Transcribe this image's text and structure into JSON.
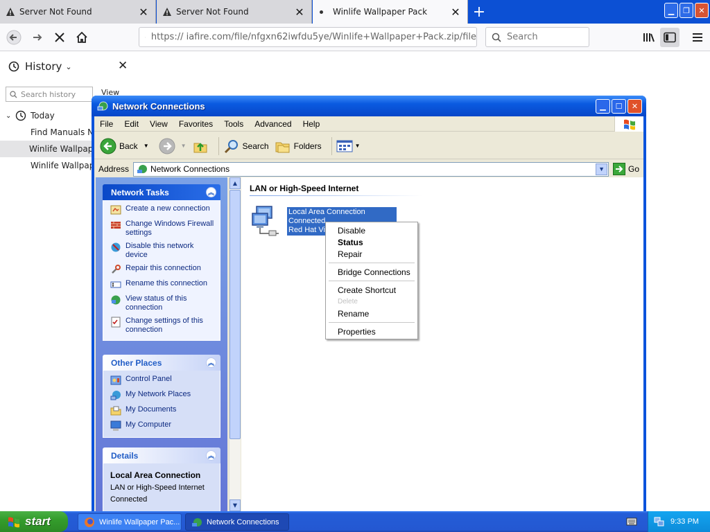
{
  "browser": {
    "tabs": [
      {
        "title": "Server Not Found",
        "close": "✕"
      },
      {
        "title": "Server Not Found",
        "close": "✕"
      },
      {
        "title": "Winlife Wallpaper Pack",
        "close": "✕"
      }
    ],
    "new_tab": "+",
    "url": "https://    iafire.com/file/nfgxn62iwfdu5ye/Winlife+Wallpaper+Pack.zip/file",
    "search_placeholder": "Search"
  },
  "sidebar": {
    "title": "History",
    "close": "✕",
    "search_placeholder": "Search history",
    "view_label": "View",
    "tree": [
      {
        "label": "Today"
      },
      {
        "label": "Find Manuals No"
      },
      {
        "label": "Winlife Wallpaper"
      },
      {
        "label": "Winlife Wallpaper"
      }
    ]
  },
  "window": {
    "title": "Network Connections",
    "menu": [
      "File",
      "Edit",
      "View",
      "Favorites",
      "Tools",
      "Advanced",
      "Help"
    ],
    "toolbar": {
      "back": "Back",
      "search": "Search",
      "folders": "Folders"
    },
    "address": {
      "label": "Address",
      "value": "Network Connections",
      "go": "Go"
    },
    "network_tasks": {
      "title": "Network Tasks",
      "items": [
        "Create a new connection",
        "Change Windows Firewall settings",
        "Disable this network device",
        "Repair this connection",
        "Rename this connection",
        "View status of this connection",
        "Change settings of this connection"
      ]
    },
    "other_places": {
      "title": "Other Places",
      "items": [
        "Control Panel",
        "My Network Places",
        "My Documents",
        "My Computer"
      ]
    },
    "details": {
      "title": "Details",
      "name": "Local Area Connection",
      "type": "LAN or High-Speed Internet",
      "status": "Connected"
    },
    "group_header": "LAN or High-Speed Internet",
    "connection": {
      "name": "Local Area Connection",
      "status": "Connected",
      "device": "Red Hat Vi"
    }
  },
  "context_menu": {
    "items": [
      "Disable",
      "Status",
      "Repair",
      "Bridge Connections",
      "Create Shortcut",
      "Delete",
      "Rename",
      "Properties"
    ]
  },
  "taskbar": {
    "start": "start",
    "buttons": [
      "Winlife Wallpaper Pac...",
      "Network Connections"
    ],
    "clock": "9:33 PM"
  }
}
